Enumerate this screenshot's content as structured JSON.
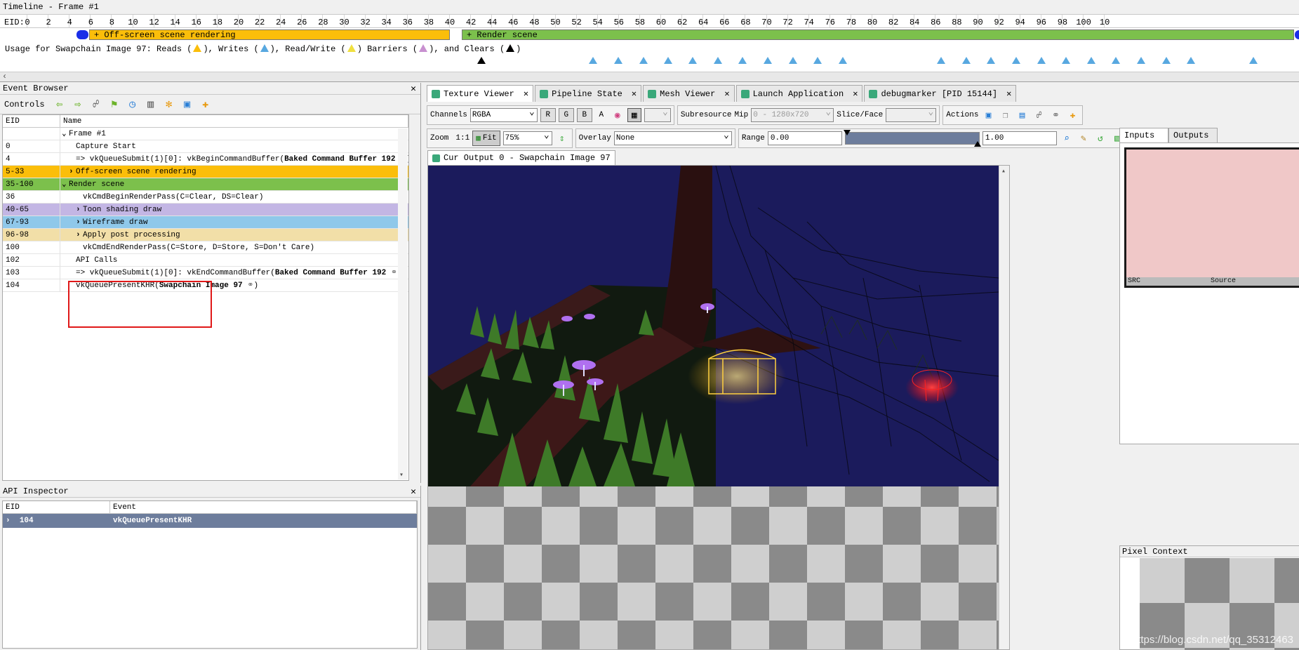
{
  "timeline": {
    "title": "Timeline - Frame #1",
    "eid_label": "EID:",
    "ticks": [
      "0",
      "2",
      "4",
      "6",
      "8",
      "10",
      "12",
      "14",
      "16",
      "18",
      "20",
      "22",
      "24",
      "26",
      "28",
      "30",
      "32",
      "34",
      "36",
      "38",
      "40",
      "42",
      "44",
      "46",
      "48",
      "50",
      "52",
      "54",
      "56",
      "58",
      "60",
      "62",
      "64",
      "66",
      "68",
      "70",
      "72",
      "74",
      "76",
      "78",
      "80",
      "82",
      "84",
      "86",
      "88",
      "90",
      "92",
      "94",
      "96",
      "98",
      "100",
      "10"
    ],
    "bar_offscreen": "+ Off-screen scene rendering",
    "bar_render": "+ Render scene",
    "usage": {
      "prefix": "Usage for Swapchain Image 97: Reads (",
      "writes": "), Writes (",
      "readwrite": "), Read/Write (",
      "barriers": ") Barriers (",
      "clears": "), and Clears (",
      "suffix": ")"
    },
    "colors": {
      "reads": "#fbbe0a",
      "writes": "#58a8e0",
      "readwrite": "#f0e040",
      "barriers": "#c890d0",
      "clears": "#000000"
    }
  },
  "event_browser": {
    "title": "Event Browser",
    "controls_label": "Controls",
    "col_eid": "EID",
    "col_name": "Name",
    "rows": [
      {
        "eid": "",
        "name": "Frame #1",
        "exp": "⌄"
      },
      {
        "eid": "0",
        "name": "Capture Start"
      },
      {
        "eid": "4",
        "name": "=> vkQueueSubmit(1)[0]: vkBeginCommandBuffer(",
        "bold": "Baked Command Buffer 192",
        "link": true,
        "tail": ")"
      },
      {
        "eid": "5-33",
        "name": "Off-screen scene rendering",
        "exp": "›"
      },
      {
        "eid": "35-100",
        "name": "Render scene",
        "exp": "⌄"
      },
      {
        "eid": "36",
        "name": "vkCmdBeginRenderPass(C=Clear, DS=Clear)"
      },
      {
        "eid": "40-65",
        "name": "Toon shading draw",
        "exp": "›"
      },
      {
        "eid": "67-93",
        "name": "Wireframe draw",
        "exp": "›"
      },
      {
        "eid": "96-98",
        "name": "Apply post processing",
        "exp": "›"
      },
      {
        "eid": "100",
        "name": "vkCmdEndRenderPass(C=Store, D=Store, S=Don't Care)"
      },
      {
        "eid": "102",
        "name": "API Calls"
      },
      {
        "eid": "103",
        "name": "=> vkQueueSubmit(1)[0]: vkEndCommandBuffer(",
        "bold": "Baked Command Buffer 192",
        "link": true,
        "tail": ")"
      },
      {
        "eid": "104",
        "name": "vkQueuePresentKHR(",
        "bold": "Swapchain Image 97",
        "link": true,
        "tail": ")"
      }
    ]
  },
  "api_inspector": {
    "title": "API Inspector",
    "col_eid": "EID",
    "col_event": "Event",
    "row_eid": "104",
    "row_event": "vkQueuePresentKHR"
  },
  "main_tabs": [
    {
      "label": "Texture Viewer"
    },
    {
      "label": "Pipeline State"
    },
    {
      "label": "Mesh Viewer"
    },
    {
      "label": "Launch Application"
    },
    {
      "label": "debugmarker [PID 15144]"
    }
  ],
  "toolbar": {
    "channels_label": "Channels",
    "channels_value": "RGBA",
    "ch_r": "R",
    "ch_g": "G",
    "ch_b": "B",
    "ch_a": "A",
    "subresource_label": "Subresource",
    "mip_label": "Mip",
    "mip_value": "0 - 1280x720",
    "slice_label": "Slice/Face",
    "actions_label": "Actions",
    "zoom_label": "Zoom",
    "zoom_11": "1:1",
    "fit_label": "Fit",
    "zoom_value": "75%",
    "overlay_label": "Overlay",
    "overlay_value": "None",
    "range_label": "Range",
    "range_min": "0.00",
    "range_max": "1.00"
  },
  "output_tab": "Cur Output 0 - Swapchain Image 97",
  "side": {
    "tab_inputs": "Inputs",
    "tab_outputs": "Outputs",
    "thumb_src": "SRC",
    "thumb_source": "Source",
    "pixel_context": "Pixel Context"
  },
  "watermark": "https://blog.csdn.net/qq_35312463"
}
